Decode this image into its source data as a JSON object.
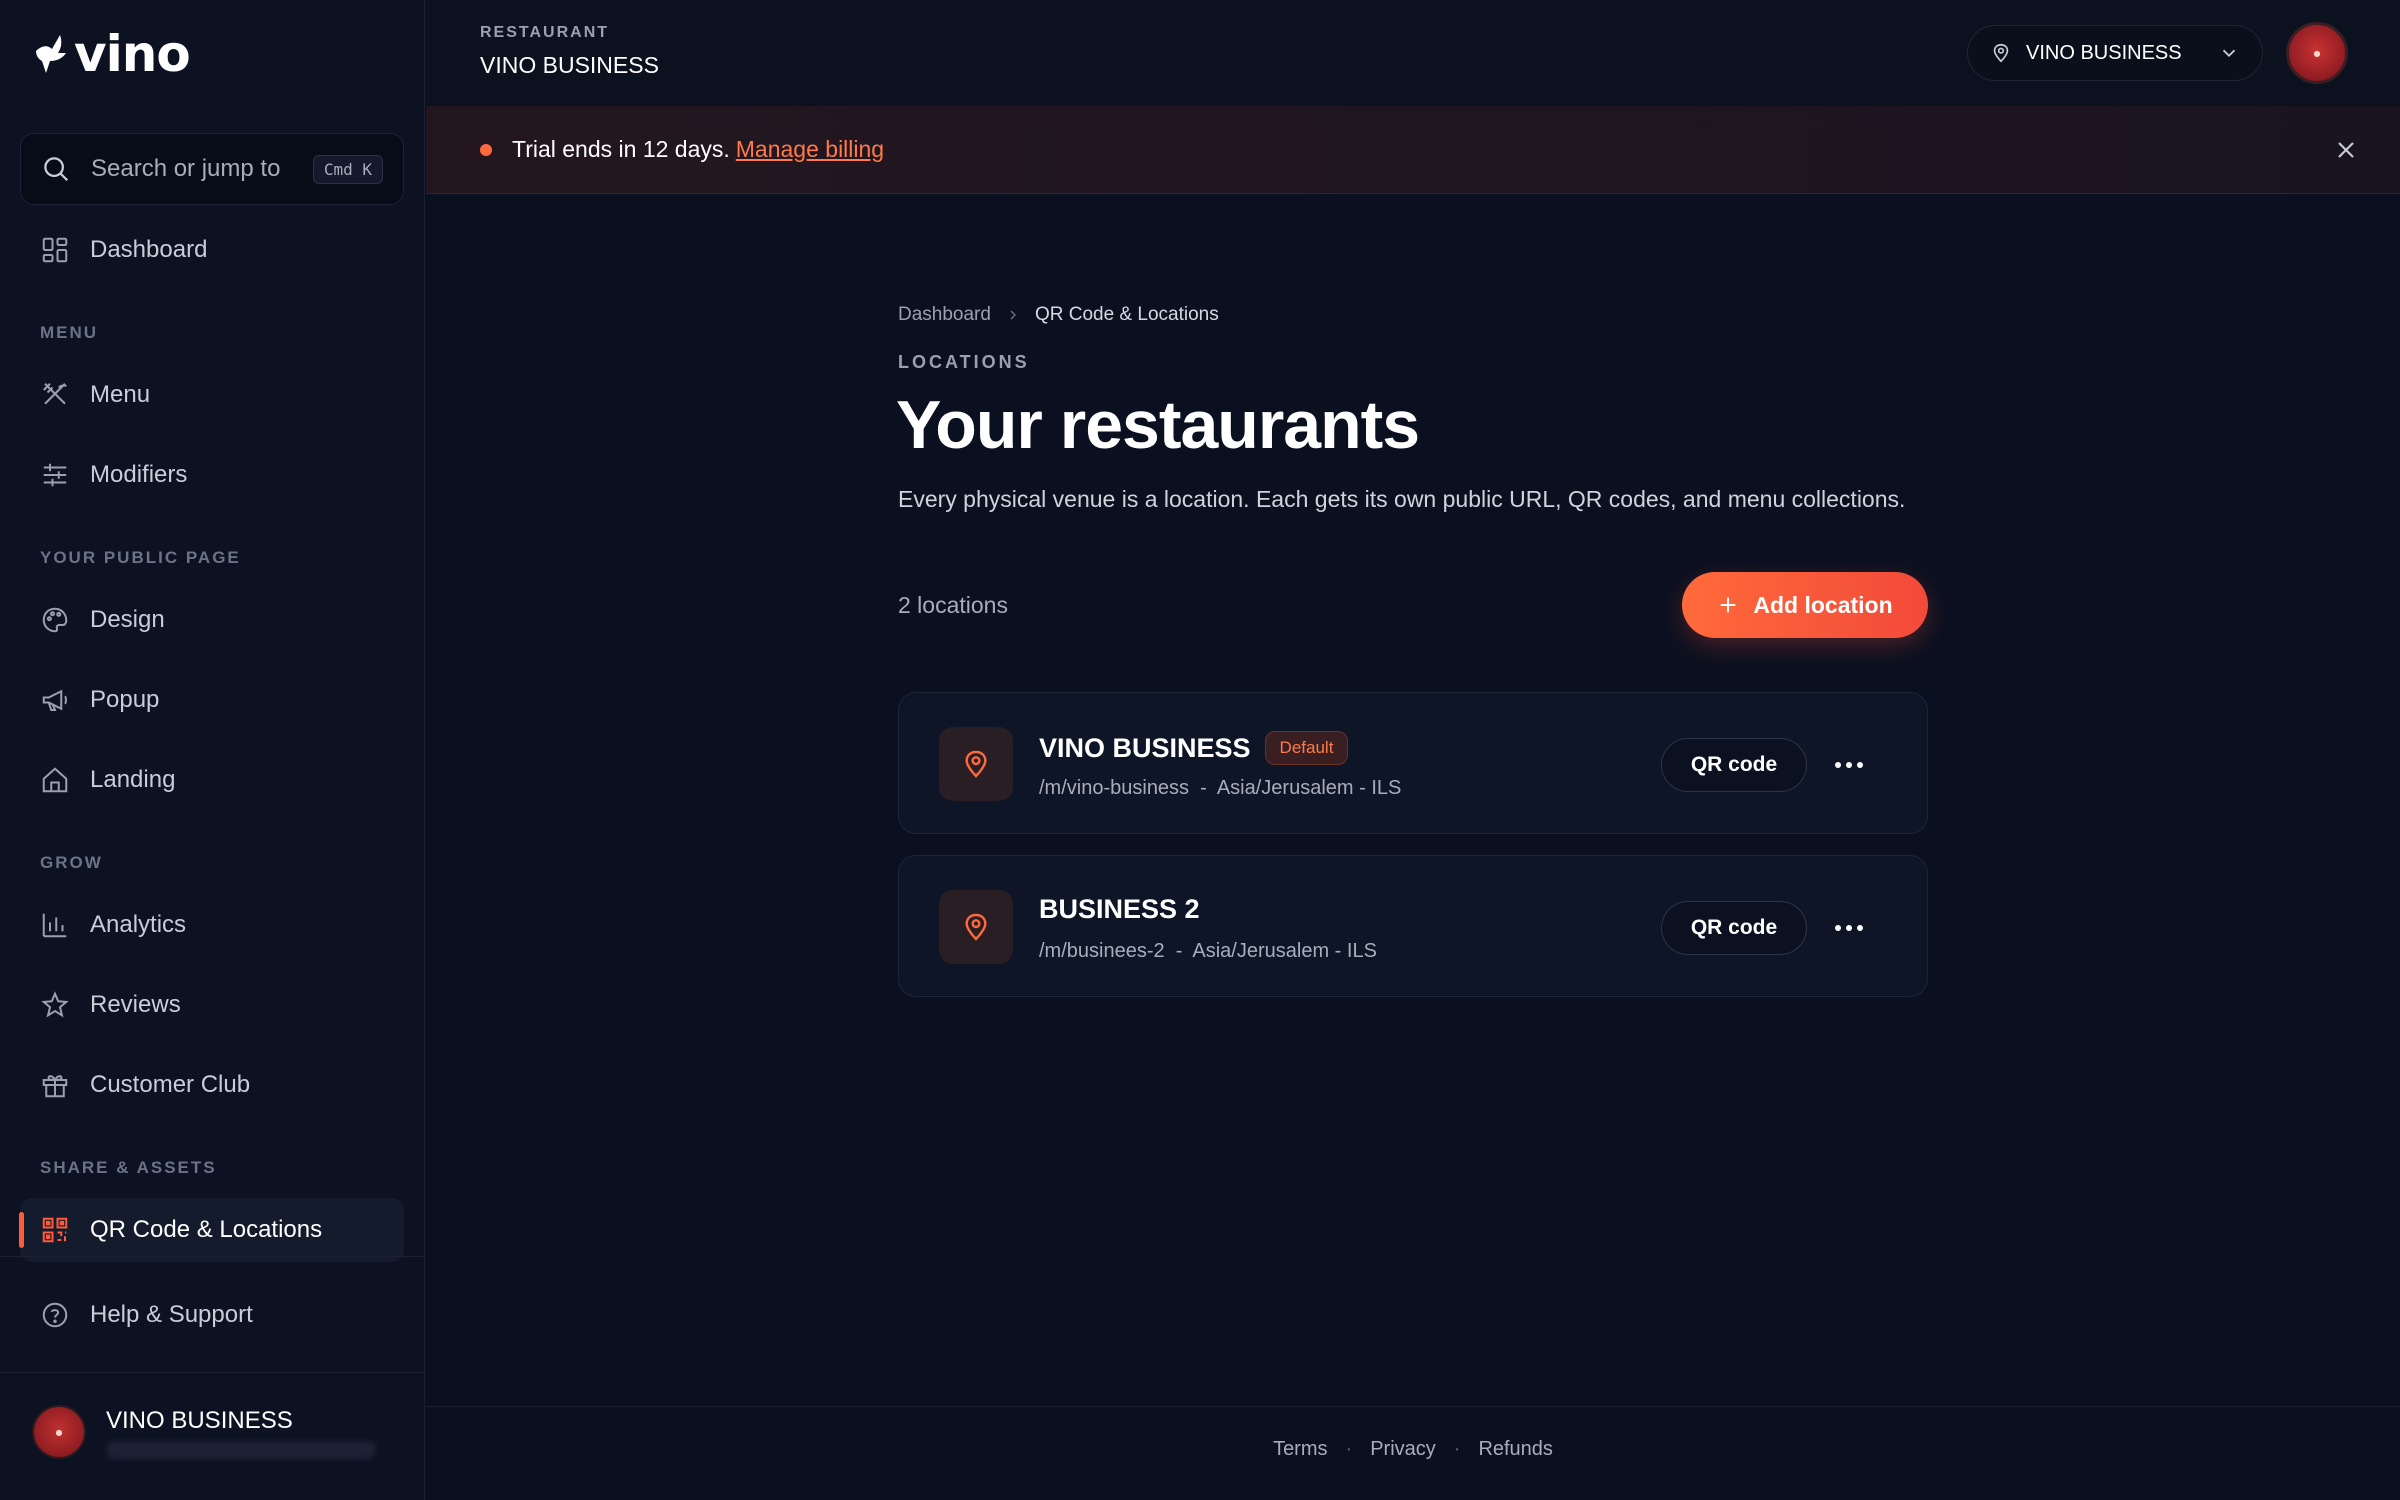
{
  "sidebar": {
    "logo": "vino",
    "search": {
      "placeholder": "Search or jump to",
      "shortcut": "Cmd K"
    },
    "dashboard_label": "Dashboard",
    "sections": {
      "menu": "MENU",
      "public_page": "YOUR PUBLIC PAGE",
      "grow": "GROW",
      "share": "SHARE & ASSETS"
    },
    "items": {
      "menu": "Menu",
      "modifiers": "Modifiers",
      "design": "Design",
      "popup": "Popup",
      "landing": "Landing",
      "analytics": "Analytics",
      "reviews": "Reviews",
      "customer_club": "Customer Club",
      "qr_locations": "QR Code & Locations",
      "help": "Help & Support"
    },
    "user": {
      "name": "VINO BUSINESS"
    },
    "accent": "#ff5a3c"
  },
  "header": {
    "eyebrow": "RESTAURANT",
    "title": "VINO BUSINESS",
    "location_select": "VINO BUSINESS"
  },
  "banner": {
    "text": "Trial ends in 12 days.",
    "link": "Manage billing"
  },
  "main": {
    "breadcrumb": [
      "Dashboard",
      "QR Code & Locations"
    ],
    "eyebrow": "LOCATIONS",
    "title": "Your restaurants",
    "subtitle": "Every physical venue is a location. Each gets its own public URL, QR codes, and menu collections.",
    "count": "2 locations",
    "add_button": "Add location",
    "locations": [
      {
        "name": "VINO BUSINESS",
        "badge": "Default",
        "meta": "/m/vino-business  -  Asia/Jerusalem - ILS",
        "qr_label": "QR code"
      },
      {
        "name": "BUSINESS 2",
        "badge": "",
        "meta": "/m/businees-2  -  Asia/Jerusalem - ILS",
        "qr_label": "QR code"
      }
    ]
  },
  "footer": {
    "links": [
      "Terms",
      "Privacy",
      "Refunds"
    ]
  }
}
